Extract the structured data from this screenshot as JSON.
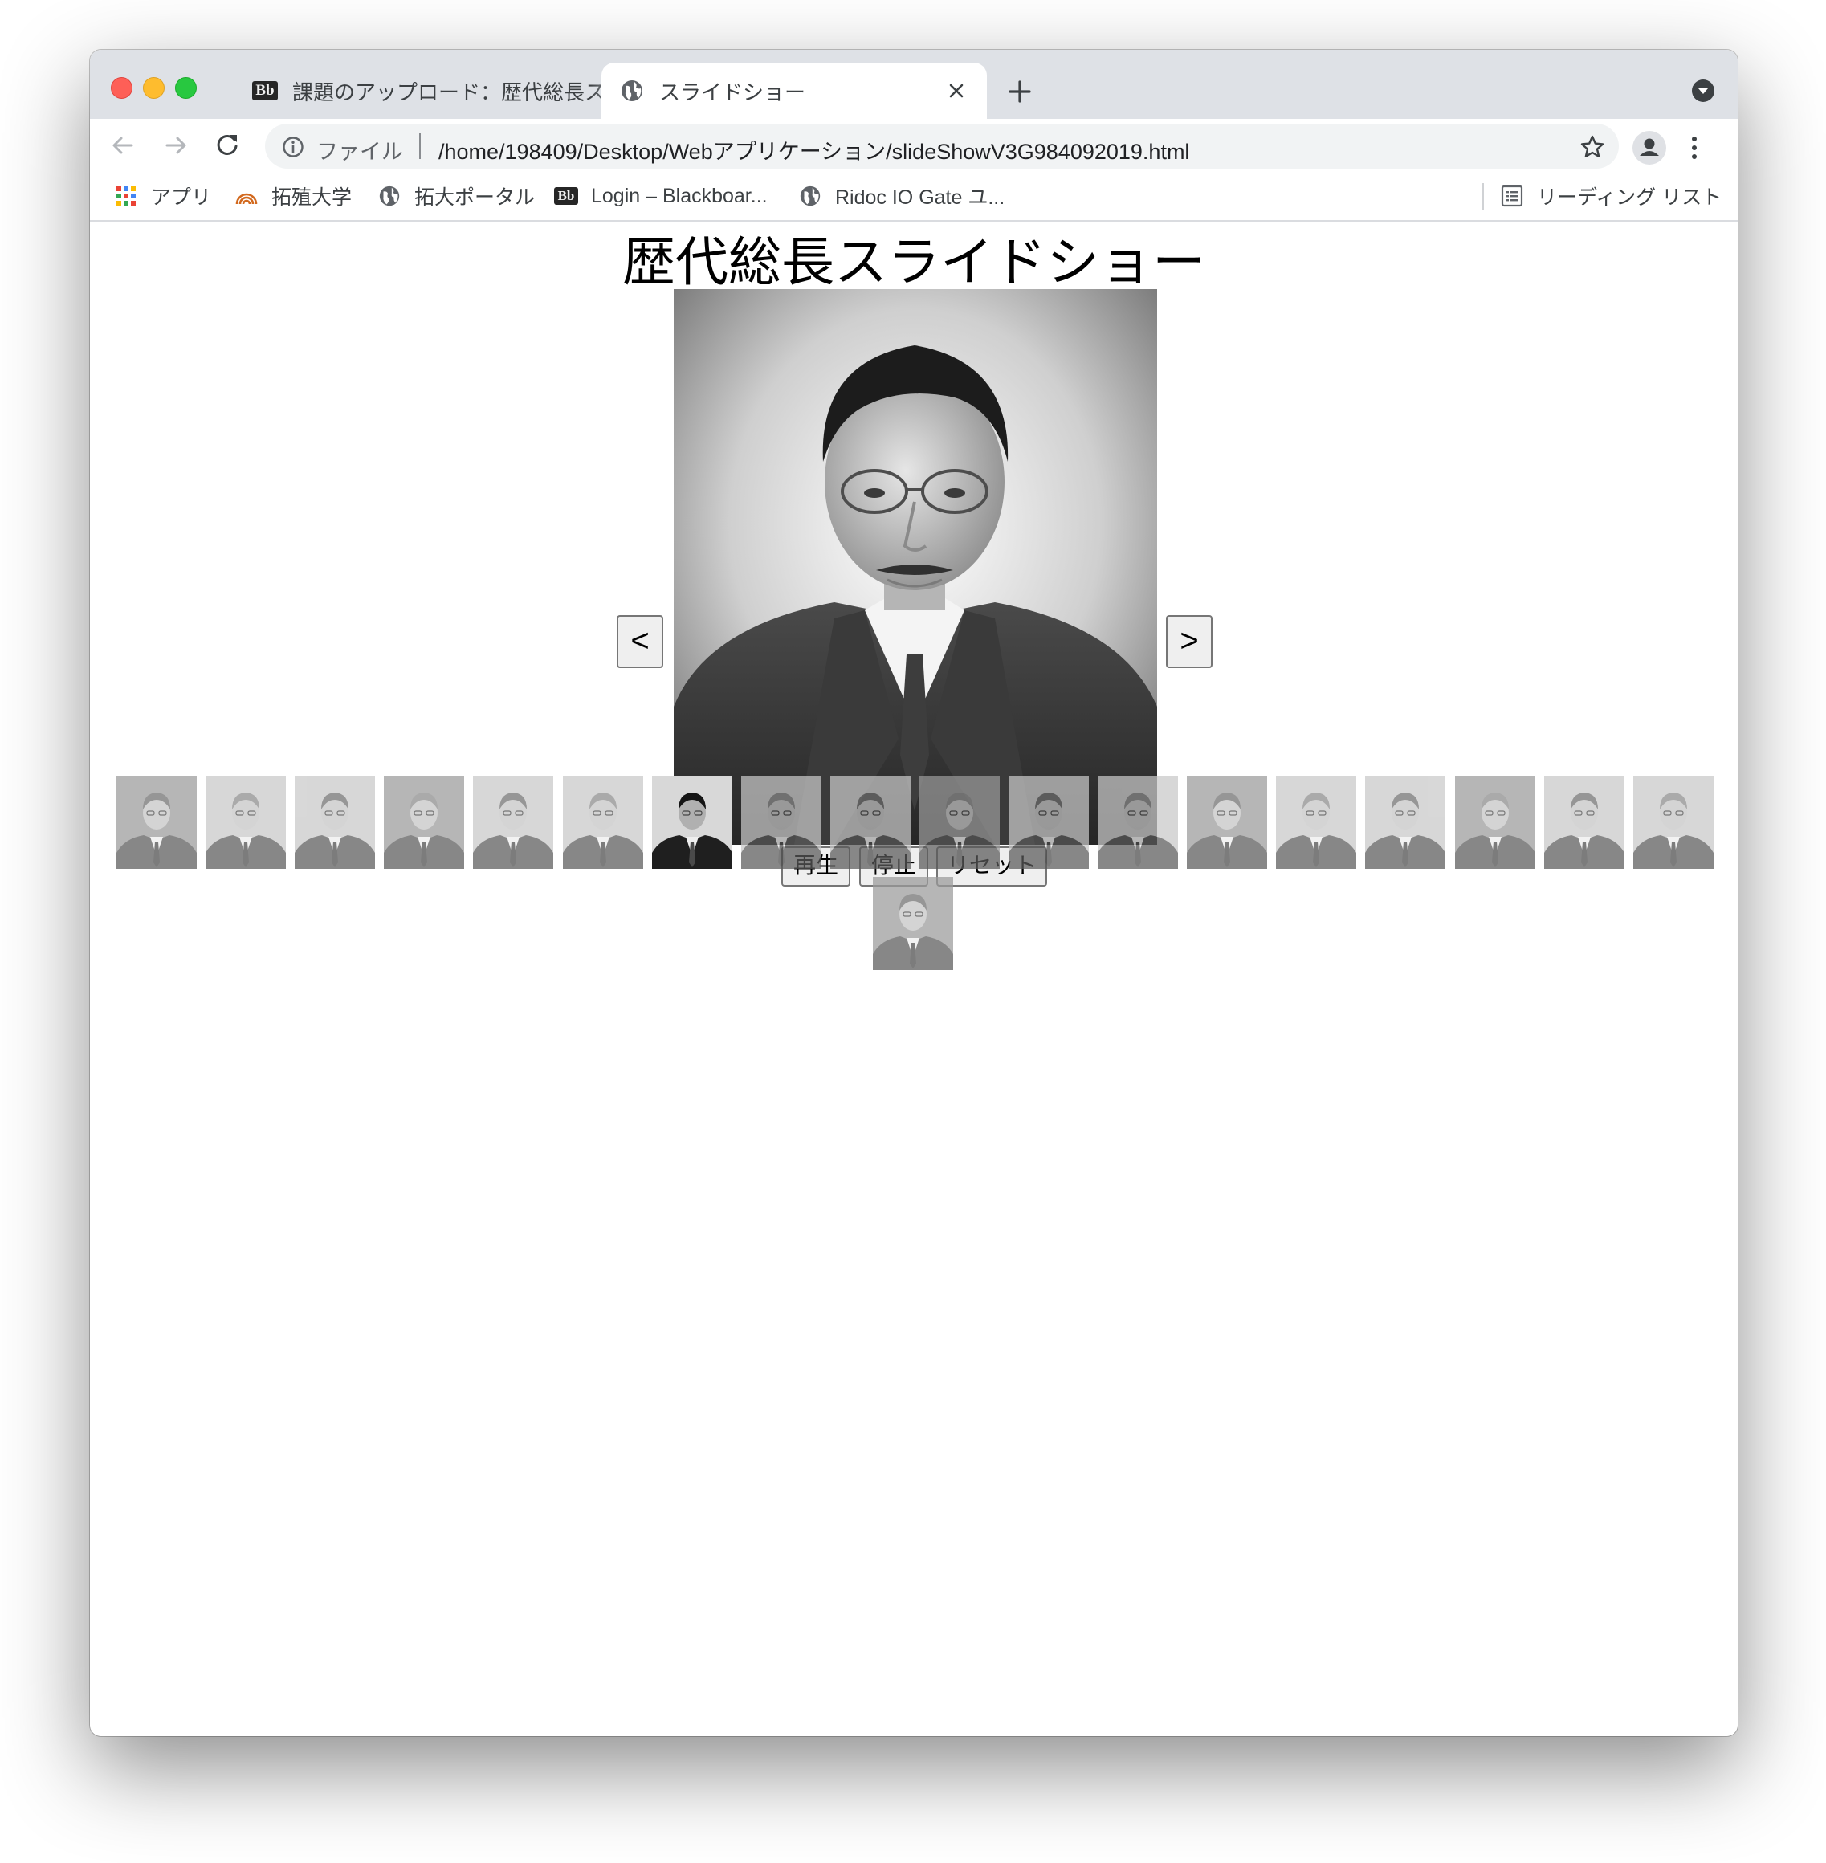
{
  "browser": {
    "tabs": [
      {
        "title": "課題のアップロード：歴代総長スライドショー",
        "favicon": "blackboard-icon",
        "active": false
      },
      {
        "title": "スライドショー",
        "favicon": "globe-icon",
        "active": true
      }
    ],
    "address": {
      "scheme_label": "ファイル",
      "url": "/home/198409/Desktop/Webアプリケーション/slideShowV3G984092019.html"
    },
    "bookmarks": [
      {
        "label": "アプリ",
        "icon": "apps-grid-icon"
      },
      {
        "label": "拓殖大学",
        "icon": "takushoku-logo-icon"
      },
      {
        "label": "拓大ポータル",
        "icon": "globe-icon"
      },
      {
        "label": "Login – Blackboar...",
        "icon": "blackboard-icon"
      },
      {
        "label": "Ridoc IO Gate ユ...",
        "icon": "globe-icon"
      }
    ],
    "reading_list": "リーディング リスト"
  },
  "page": {
    "title": "歴代総長スライドショー",
    "prev_label": "<",
    "next_label": ">",
    "controls": {
      "play": "再生",
      "stop": "停止",
      "reset": "リセット"
    },
    "thumbnails_count": 19,
    "selected_index": 6
  }
}
